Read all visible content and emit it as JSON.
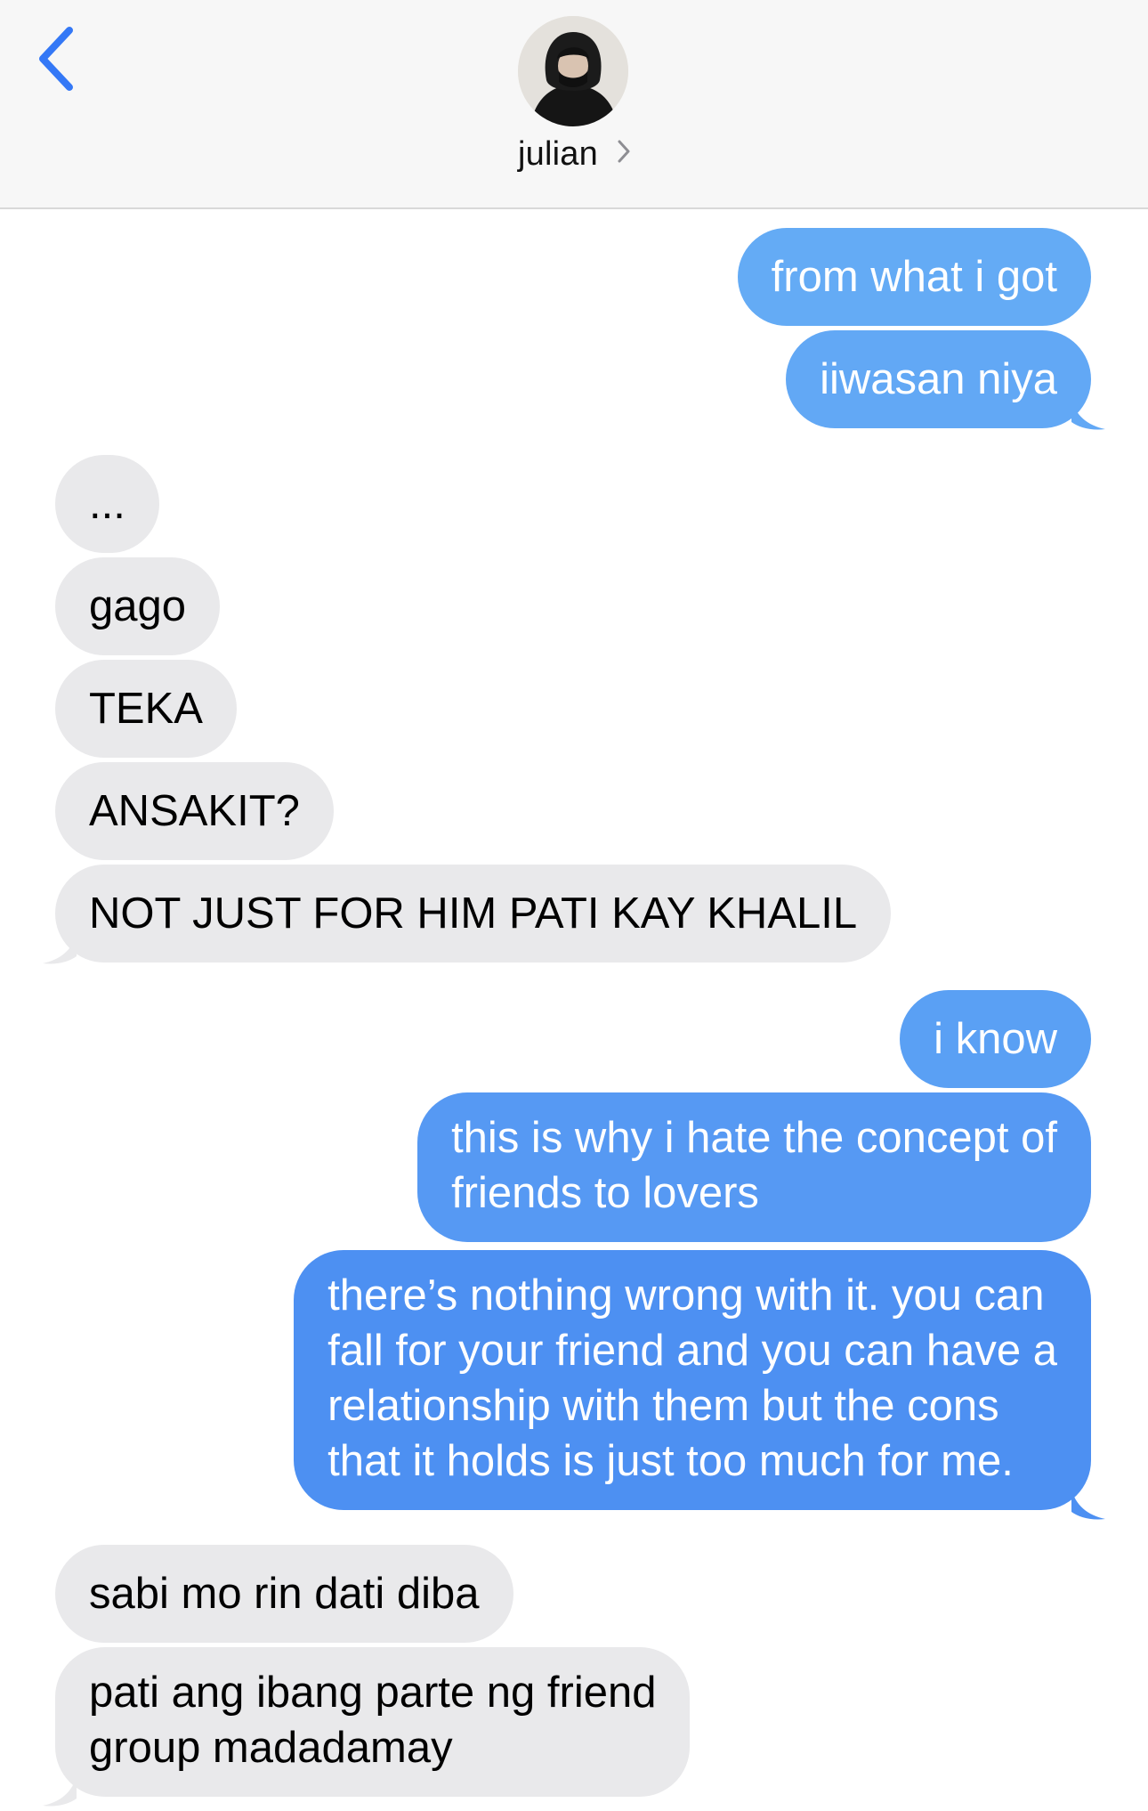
{
  "header": {
    "back_icon": "chevron-left-icon",
    "contact_name": "julian",
    "contact_chevron_icon": "chevron-right-icon",
    "avatar_icon": "avatar-photo"
  },
  "colors": {
    "sent_bubble": "#4f97f2",
    "received_bubble": "#e9e9eb",
    "back_chevron": "#3478f6",
    "header_bg": "#f7f7f7"
  },
  "messages": [
    {
      "from": "me",
      "lines": [
        "from what i got"
      ]
    },
    {
      "from": "me",
      "lines": [
        "iiwasan niya"
      ]
    },
    {
      "from": "julian",
      "lines": [
        "..."
      ]
    },
    {
      "from": "julian",
      "lines": [
        "gago"
      ]
    },
    {
      "from": "julian",
      "lines": [
        "TEKA"
      ]
    },
    {
      "from": "julian",
      "lines": [
        "ANSAKIT?"
      ]
    },
    {
      "from": "julian",
      "lines": [
        "NOT JUST FOR HIM PATI KAY KHALIL"
      ]
    },
    {
      "from": "me",
      "lines": [
        "i know"
      ]
    },
    {
      "from": "me",
      "lines": [
        "this is why i hate the concept of",
        "friends to lovers"
      ]
    },
    {
      "from": "me",
      "lines": [
        "there’s nothing wrong with it. you can",
        "fall for your friend and you can have a",
        "relationship with them but the cons",
        "that it holds is just too much for me."
      ]
    },
    {
      "from": "julian",
      "lines": [
        "sabi mo rin dati diba"
      ]
    },
    {
      "from": "julian",
      "lines": [
        "pati ang ibang parte ng friend",
        "group madadamay"
      ]
    }
  ]
}
